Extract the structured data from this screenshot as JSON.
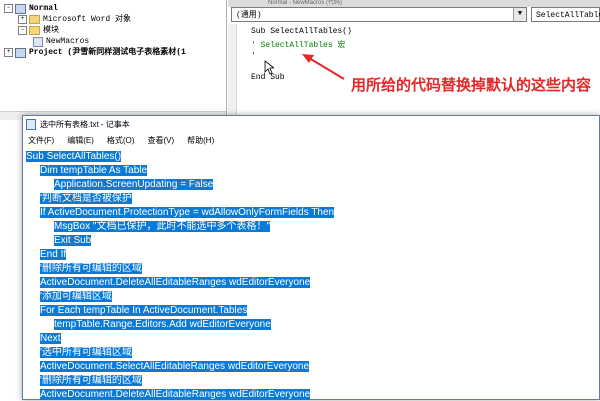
{
  "tree": {
    "normal_label": "Normal",
    "word_objects_label": "Microsoft Word 对象",
    "modules_label": "模块",
    "newmacros_label": "NewMacros",
    "project_label": "Project (尹雪新同样测试电子表格素材(1"
  },
  "vbe": {
    "title_fragment": "Normal - NewMacros (代码)",
    "object_combo": "(通用)",
    "proc_combo": "SelectAllTables",
    "code_lines": [
      "Sub SelectAllTables()",
      "' SelectAllTables 宏",
      "'",
      "End Sub"
    ]
  },
  "annotation": {
    "text": "用所给的代码替换掉默认的这些内容",
    "color": "#e52727"
  },
  "notepad": {
    "title": "选中所有表格.txt - 记事本",
    "menu": [
      "文件(F)",
      "编辑(E)",
      "格式(O)",
      "查看(V)",
      "帮助(H)"
    ],
    "lines": [
      "Sub SelectAllTables()",
      "Dim tempTable As Table",
      "Application.ScreenUpdating = False",
      "'判断文档是否被保护",
      "If ActiveDocument.ProtectionType = wdAllowOnlyFormFields Then",
      "MsgBox \"文档已保护，此时不能选中多个表格！\"",
      "Exit Sub",
      "End If",
      "'删除所有可编辑的区域",
      "ActiveDocument.DeleteAllEditableRanges wdEditorEveryone",
      "'添加可编辑区域",
      "For Each tempTable In ActiveDocument.Tables",
      "tempTable.Range.Editors.Add wdEditorEveryone",
      "Next",
      "'选中所有可编辑区域",
      "ActiveDocument.SelectAllEditableRanges wdEditorEveryone",
      "'删除所有可编辑的区域",
      "ActiveDocument.DeleteAllEditableRanges wdEditorEveryone"
    ],
    "selection_color": "#0a7ad9"
  }
}
